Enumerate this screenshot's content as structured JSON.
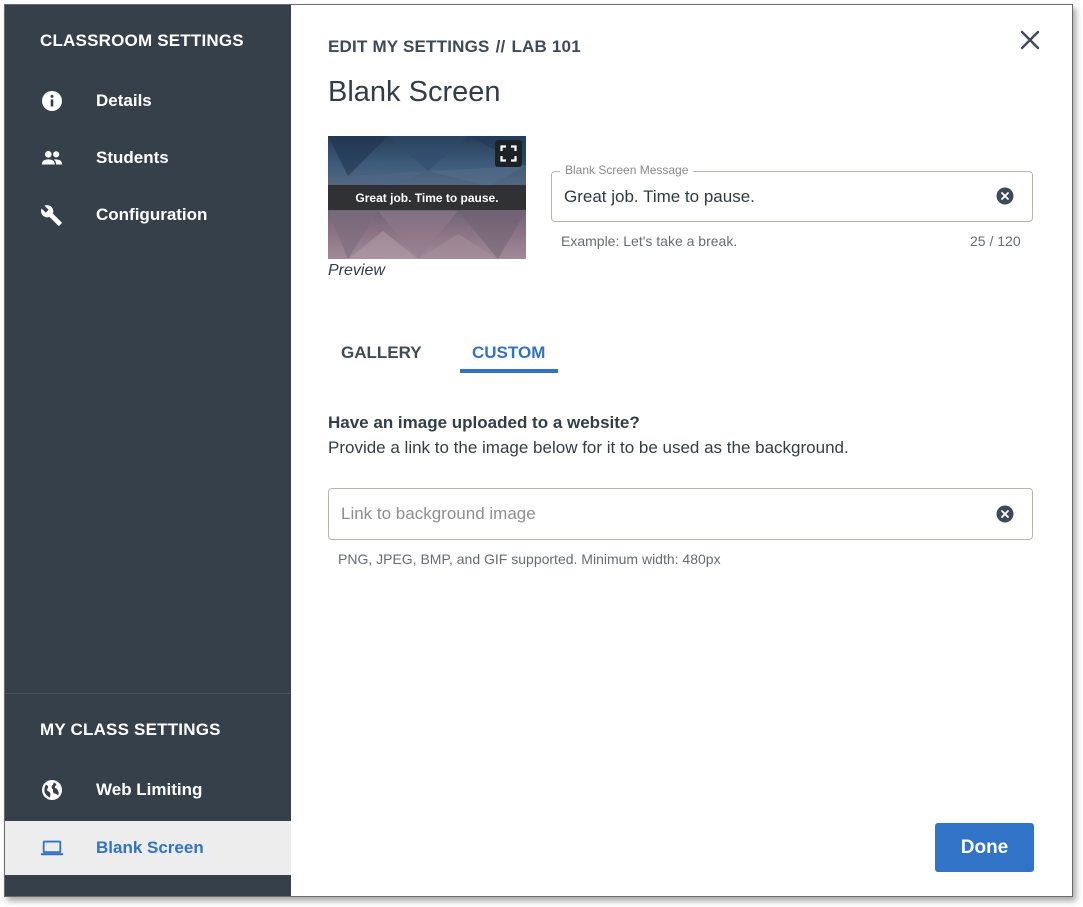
{
  "sidebar": {
    "heading_classroom": "CLASSROOM SETTINGS",
    "classroom_items": [
      {
        "label": "Details",
        "icon": "info-icon"
      },
      {
        "label": "Students",
        "icon": "people-icon"
      },
      {
        "label": "Configuration",
        "icon": "wrench-icon"
      }
    ],
    "heading_my_class": "MY CLASS SETTINGS",
    "my_class_items": [
      {
        "label": "Web Limiting",
        "icon": "globe-icon"
      },
      {
        "label": "Blank Screen",
        "icon": "laptop-icon",
        "active": true
      }
    ]
  },
  "header": {
    "breadcrumb_part1": "EDIT MY SETTINGS",
    "breadcrumb_separator": "//",
    "breadcrumb_part2": "LAB 101",
    "title": "Blank Screen"
  },
  "preview": {
    "message": "Great job. Time to pause.",
    "caption": "Preview"
  },
  "message_field": {
    "legend": "Blank Screen Message",
    "value": "Great job. Time to pause.",
    "helper": "Example: Let's take a break.",
    "counter": "25 / 120"
  },
  "tabs": [
    {
      "label": "GALLERY",
      "active": false
    },
    {
      "label": "CUSTOM",
      "active": true
    }
  ],
  "custom": {
    "heading": "Have an image uploaded to a website?",
    "description": "Provide a link to the image below for it to be used as the background.",
    "link_placeholder": "Link to background image",
    "link_helper": "PNG, JPEG, BMP, and GIF supported. Minimum width: 480px"
  },
  "footer": {
    "done_label": "Done"
  },
  "colors": {
    "sidebar_bg": "#36404a",
    "accent": "#3173c6",
    "active_item_bg": "#ededed"
  }
}
